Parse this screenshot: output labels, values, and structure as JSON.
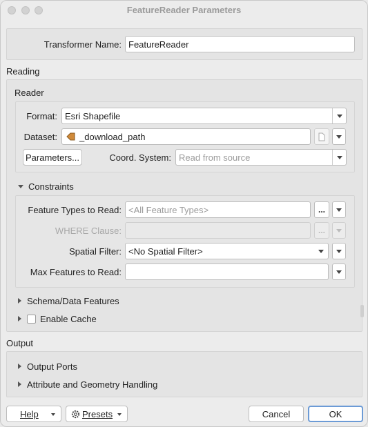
{
  "window": {
    "title": "FeatureReader Parameters"
  },
  "transformer": {
    "label": "Transformer Name:",
    "value": "FeatureReader"
  },
  "reading": {
    "section_label": "Reading",
    "reader": {
      "group_label": "Reader",
      "format_label": "Format:",
      "format_value": "Esri Shapefile",
      "dataset_label": "Dataset:",
      "dataset_value": "_download_path",
      "parameters_button": "Parameters...",
      "coord_label": "Coord. System:",
      "coord_placeholder": "Read from source"
    },
    "constraints": {
      "label": "Constraints",
      "feature_types_label": "Feature Types to Read:",
      "feature_types_placeholder": "<All Feature Types>",
      "where_label": "WHERE Clause:",
      "spatial_filter_label": "Spatial Filter:",
      "spatial_filter_value": "<No Spatial Filter>",
      "max_features_label": "Max Features to Read:",
      "max_features_value": "",
      "dots": "..."
    },
    "schema_label": "Schema/Data Features",
    "enable_cache_label": "Enable Cache"
  },
  "output": {
    "section_label": "Output",
    "ports_label": "Output Ports",
    "attr_label": "Attribute and Geometry Handling"
  },
  "footer": {
    "help": "Help",
    "presets": "Presets",
    "cancel": "Cancel",
    "ok": "OK"
  },
  "colors": {
    "dataset_icon": "#d08a3a",
    "ok_border": "#6c9bd6"
  }
}
